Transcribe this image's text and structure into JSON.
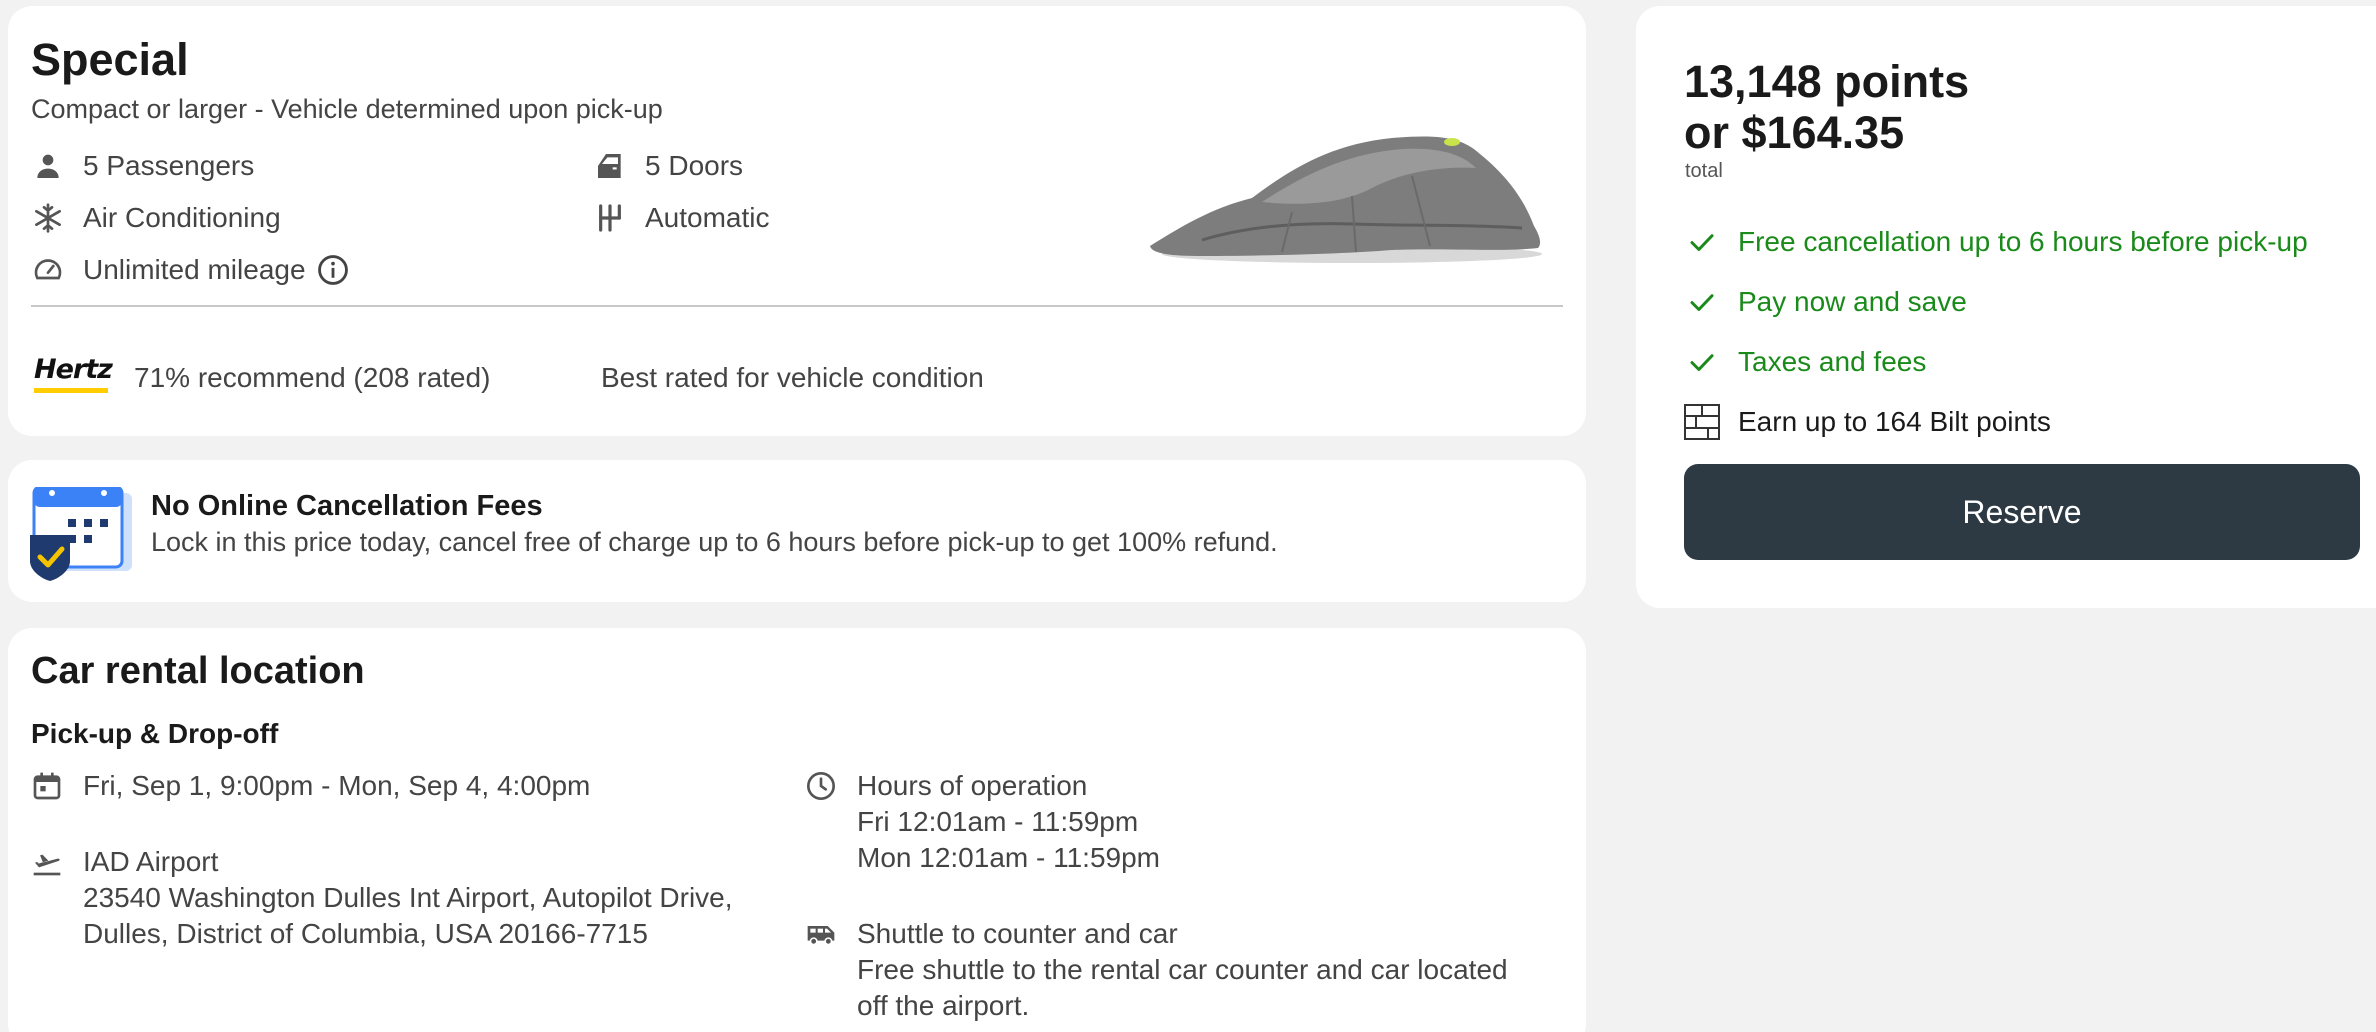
{
  "vehicle": {
    "title": "Special",
    "subtitle": "Compact or larger - Vehicle determined upon pick-up",
    "features": {
      "passengers": "5 Passengers",
      "doors": "5 Doors",
      "ac": "Air Conditioning",
      "transmission": "Automatic",
      "mileage": "Unlimited mileage"
    },
    "supplier_logo_text": "Hertz",
    "rating": "71% recommend (208 rated)",
    "best_rated": "Best rated for vehicle condition"
  },
  "cancellation": {
    "title": "No Online Cancellation Fees",
    "description": "Lock in this price today, cancel free of charge up to 6 hours before pick-up to get 100% refund."
  },
  "location": {
    "title": "Car rental location",
    "subtitle": "Pick-up & Drop-off",
    "dates": "Fri, Sep 1, 9:00pm - Mon, Sep 4, 4:00pm",
    "airport_name": "IAD Airport",
    "address_line1": "23540 Washington Dulles Int Airport, Autopilot Drive,",
    "address_line2": "Dulles, District of Columbia, USA 20166-7715",
    "hours_title": "Hours of operation",
    "hours_fri": "Fri 12:01am - 11:59pm",
    "hours_mon": "Mon 12:01am - 11:59pm",
    "shuttle_title": "Shuttle to counter and car",
    "shuttle_line1": "Free shuttle to the rental car counter and car located",
    "shuttle_line2": "off the airport."
  },
  "price": {
    "points": "13,148 points",
    "cash": "or $164.35",
    "total_label": "total",
    "perks": [
      "Free cancellation up to 6 hours before pick-up",
      "Pay now and save",
      "Taxes and fees"
    ],
    "bilt": "Earn up to 164 Bilt points",
    "reserve_label": "Reserve"
  },
  "colors": {
    "accent_green": "#1a8a1a",
    "button_dark": "#2d3a44",
    "hertz_yellow": "#ffcc00"
  }
}
